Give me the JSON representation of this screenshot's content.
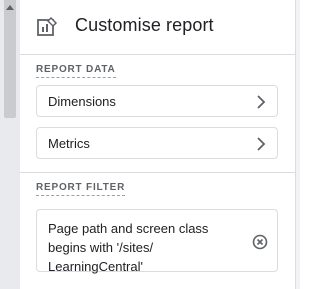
{
  "header": {
    "title": "Customise report",
    "icon": "customise-report-icon"
  },
  "report_data": {
    "label": "REPORT DATA",
    "items": [
      {
        "label": "Dimensions",
        "icon": "chevron-right-icon"
      },
      {
        "label": "Metrics",
        "icon": "chevron-right-icon"
      }
    ]
  },
  "report_filter": {
    "label": "REPORT FILTER",
    "filter_text": "Page path and screen class begins with '/sites/ LearningCentral'",
    "remove_icon": "close-circle-icon"
  },
  "colors": {
    "text": "#202124",
    "muted": "#5f6368",
    "border": "#dadce0"
  }
}
